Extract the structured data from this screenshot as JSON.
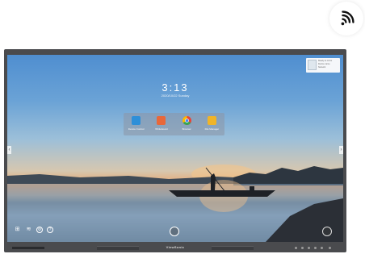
{
  "icons": {
    "wifi": "wifi-icon",
    "network": "network-icon",
    "settings": "settings-icon",
    "info": "info-icon",
    "help": "help-icon",
    "home": "home-icon",
    "apps": "apps-icon"
  },
  "home": {
    "clock": "3:13",
    "date": "2020/10/22 Sunday"
  },
  "apps": [
    {
      "label": "Device Control",
      "color": "#2e8fd8"
    },
    {
      "label": "Whiteboard",
      "color": "#e8683a"
    },
    {
      "label": "Browser",
      "color": "#ffffff"
    },
    {
      "label": "File Manager",
      "color": "#f0b428"
    }
  ],
  "widget": {
    "lines": [
      "Ready to mirror",
      "Device name",
      "Network"
    ]
  },
  "bezel": {
    "brand": "ViewSonic"
  }
}
